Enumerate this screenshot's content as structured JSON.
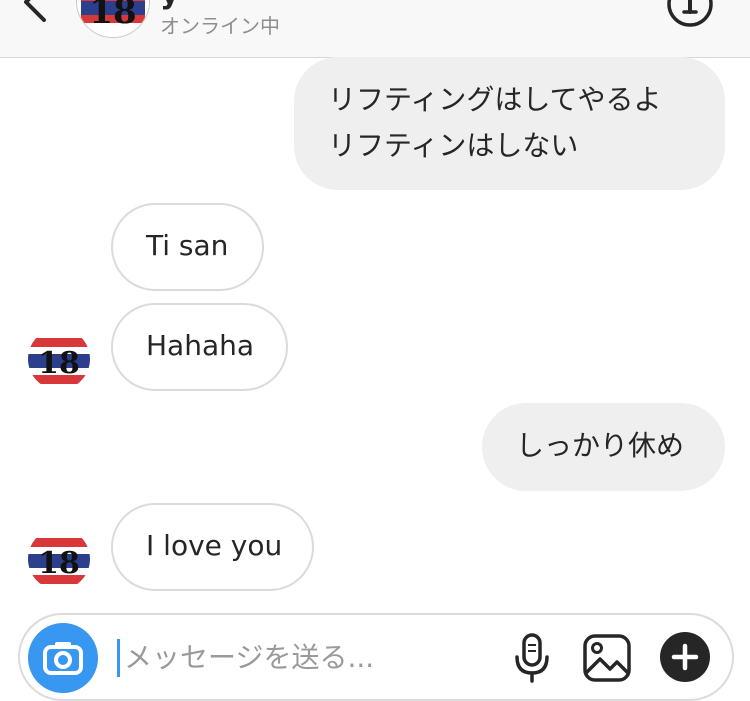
{
  "header": {
    "name": "y",
    "status": "オンライン中"
  },
  "messages": [
    {
      "direction": "outgoing",
      "lines": [
        "リフティングはしてやるよ",
        "リフティンはしない"
      ]
    },
    {
      "direction": "incoming",
      "text": "Ti san"
    },
    {
      "direction": "incoming",
      "text": "Hahaha"
    },
    {
      "direction": "outgoing",
      "text": "しっかり休め"
    },
    {
      "direction": "incoming",
      "text": "I love you"
    }
  ],
  "avatar": {
    "badge_text": "18"
  },
  "composer": {
    "placeholder": "メッセージを送る..."
  },
  "colors": {
    "accent": "#3897f0",
    "outgoing_bubble": "#efefef",
    "incoming_border": "#dbdbdb"
  }
}
